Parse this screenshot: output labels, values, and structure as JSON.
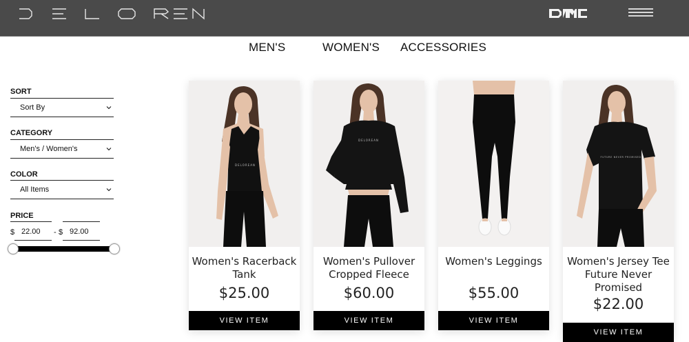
{
  "header": {
    "brand": "DELOREAN",
    "sub_brand": "DMC",
    "menu_icon": "hamburger-icon"
  },
  "nav": {
    "items": [
      "MEN'S",
      "WOMEN'S",
      "ACCESSORIES"
    ]
  },
  "filters": {
    "sort": {
      "label": "SORT",
      "value": "Sort By"
    },
    "category": {
      "label": "CATEGORY",
      "value": "Men's / Women's"
    },
    "color": {
      "label": "COLOR",
      "value": "All Items"
    },
    "price": {
      "label": "PRICE",
      "currency": "$",
      "min": "22.00",
      "max": "92.00",
      "separator": "-"
    }
  },
  "products": [
    {
      "name": "Women's Racerback Tank",
      "price": "$25.00",
      "button": "VIEW ITEM"
    },
    {
      "name": "Women's Pullover Cropped Fleece",
      "price": "$60.00",
      "button": "VIEW ITEM"
    },
    {
      "name": "Women's Leggings",
      "price": "$55.00",
      "button": "VIEW ITEM"
    },
    {
      "name": "Women's Jersey Tee Future Never Promised",
      "price": "$22.00",
      "button": "VIEW ITEM"
    }
  ],
  "colors": {
    "header_bg": "#4a4a4a",
    "button_bg": "#000000",
    "button_text": "#ffffff"
  }
}
